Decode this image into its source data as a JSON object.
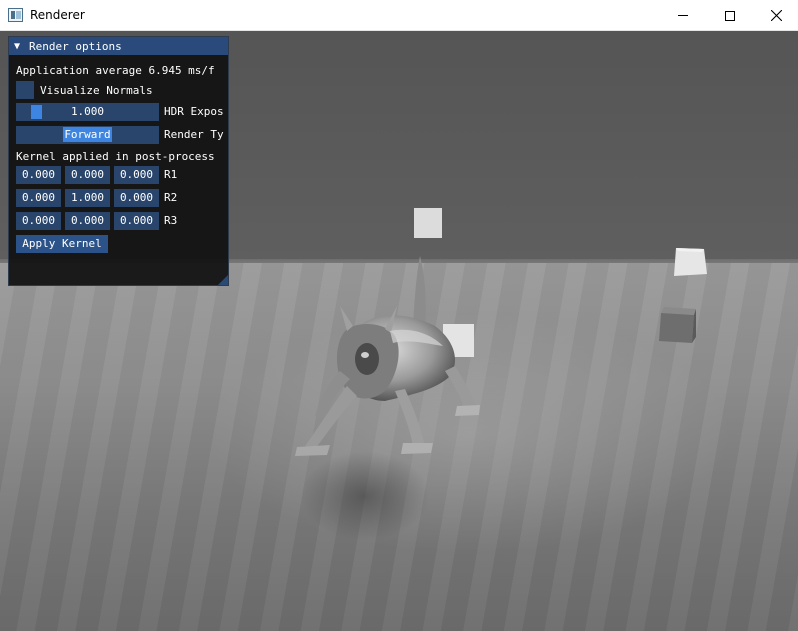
{
  "window": {
    "title": "Renderer",
    "icon": "app-window-icon",
    "buttons": [
      "minimize-icon",
      "maximize-icon",
      "close-icon"
    ]
  },
  "panel": {
    "header": "Render options",
    "collapse_arrow": "▼",
    "stats_text": "Application average 6.945 ms/f",
    "visualize_normals_label": "Visualize Normals",
    "visualize_normals_checked": false,
    "hdr_exposure_value": "1.000",
    "hdr_exposure_label": "HDR Expos",
    "render_type_value": "Forward",
    "render_type_label": "Render Ty",
    "kernel_label": "Kernel applied in post-process",
    "kernel_rows": [
      {
        "label": "R1",
        "values": [
          "0.000",
          "0.000",
          "0.000"
        ]
      },
      {
        "label": "R2",
        "values": [
          "0.000",
          "1.000",
          "0.000"
        ]
      },
      {
        "label": "R3",
        "values": [
          "0.000",
          "0.000",
          "0.000"
        ]
      }
    ],
    "apply_button": "Apply Kernel"
  },
  "colors": {
    "panel_header": "#294a7a",
    "widget_bg": "#29456b",
    "accent": "#3d85e0",
    "button": "#2c5389"
  }
}
